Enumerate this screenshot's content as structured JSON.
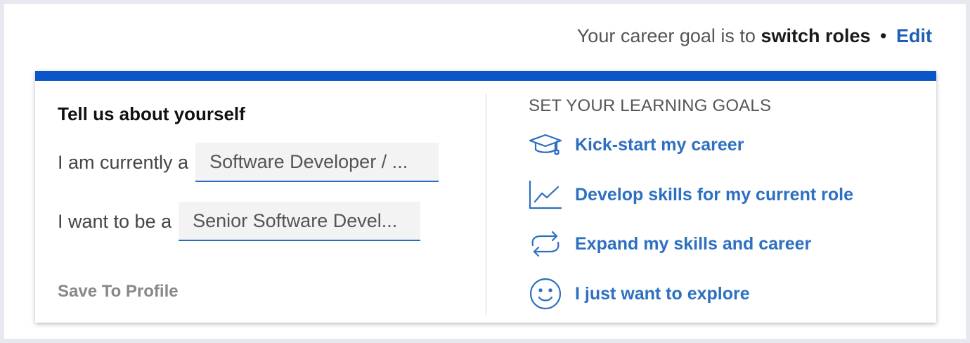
{
  "header": {
    "goal_prefix": "Your career goal is to",
    "goal_value": "switch roles",
    "separator": "•",
    "edit_label": "Edit"
  },
  "profile_form": {
    "title": "Tell us about yourself",
    "current_label": "I am currently a",
    "current_value": "Software Developer / ...",
    "target_label": "I want to be a",
    "target_value": "Senior Software Devel...",
    "save_label": "Save To Profile"
  },
  "learning_goals": {
    "heading": "SET YOUR LEARNING GOALS",
    "items": [
      {
        "label": "Kick-start my career",
        "icon": "graduation-cap-icon"
      },
      {
        "label": "Develop skills for my current role",
        "icon": "line-chart-icon"
      },
      {
        "label": "Expand my skills and career",
        "icon": "cycle-arrows-icon"
      },
      {
        "label": "I just want to explore",
        "icon": "smiley-face-icon"
      }
    ]
  },
  "colors": {
    "accent_bar": "#0a56c9",
    "link": "#2d6fc0",
    "edit": "#1f5fb3",
    "muted": "#888888"
  }
}
